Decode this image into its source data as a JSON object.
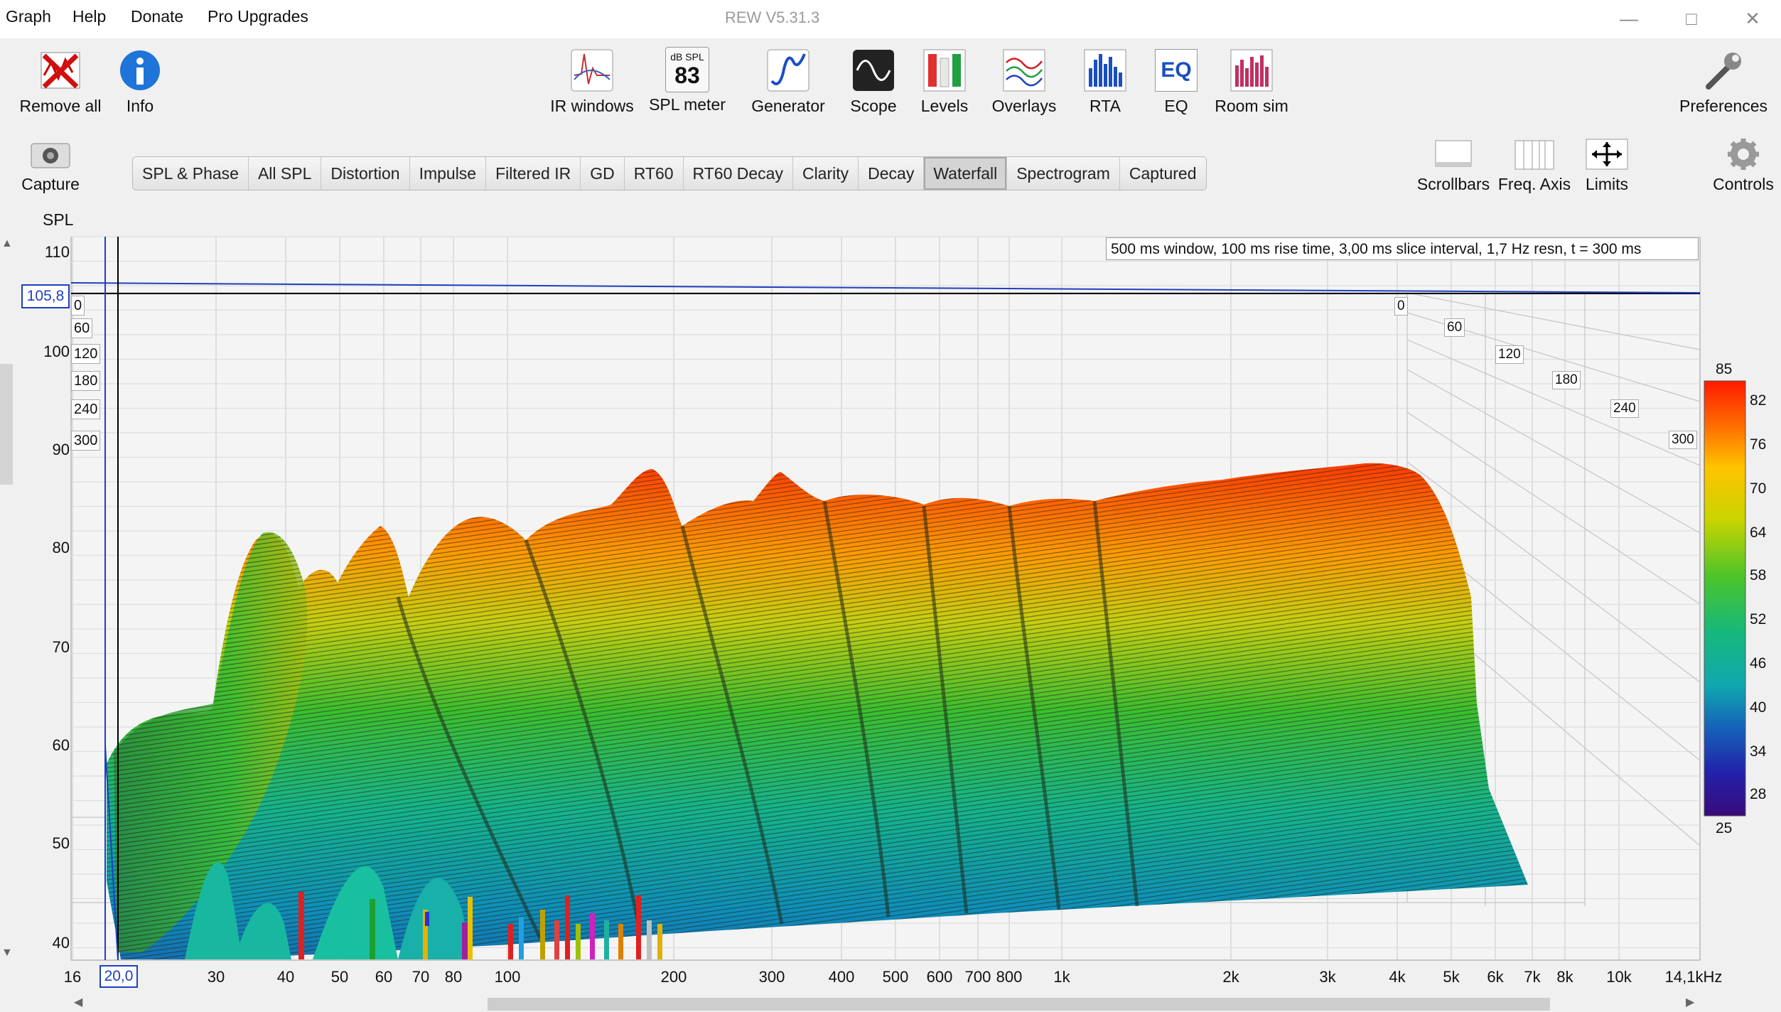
{
  "app": {
    "title": "REW V5.31.3",
    "menu": [
      "Graph",
      "Help",
      "Donate",
      "Pro Upgrades"
    ]
  },
  "toolbar": {
    "remove_all": "Remove all",
    "info": "Info",
    "ir_windows": "IR windows",
    "spl_meter": "SPL meter",
    "spl_meter_unit": "dB SPL",
    "spl_meter_value": "83",
    "generator": "Generator",
    "scope": "Scope",
    "levels": "Levels",
    "overlays": "Overlays",
    "rta": "RTA",
    "eq": "EQ",
    "eq_icon_text": "EQ",
    "room_sim": "Room sim",
    "preferences": "Preferences",
    "capture": "Capture",
    "scrollbars": "Scrollbars",
    "freq_axis": "Freq. Axis",
    "limits": "Limits",
    "controls": "Controls"
  },
  "tabs": [
    "SPL & Phase",
    "All SPL",
    "Distortion",
    "Impulse",
    "Filtered IR",
    "GD",
    "RT60",
    "RT60 Decay",
    "Clarity",
    "Decay",
    "Waterfall",
    "Spectrogram",
    "Captured"
  ],
  "active_tab": "Waterfall",
  "graph": {
    "y_axis_label": "SPL",
    "y_ticks": [
      "110",
      "100",
      "90",
      "80",
      "70",
      "60",
      "50",
      "40"
    ],
    "x_ticks": [
      "16",
      "30",
      "40",
      "50",
      "60",
      "70",
      "80",
      "100",
      "200",
      "300",
      "400",
      "500",
      "600",
      "700",
      "800",
      "1k",
      "2k",
      "3k",
      "4k",
      "5k",
      "6k",
      "7k",
      "8k",
      "10k",
      "14,1kHz"
    ],
    "cursor_x": "20,0",
    "cursor_y": "105,8",
    "info_text": "500 ms window, 100 ms rise time, 3,00 ms slice interval, 1,7 Hz resn, t = 300 ms",
    "time_labels_left": [
      "0",
      "60",
      "120",
      "180",
      "240",
      "300"
    ],
    "time_labels_right": [
      "0",
      "60",
      "120",
      "180",
      "240",
      "300"
    ],
    "color_scale": [
      "85",
      "82",
      "76",
      "70",
      "64",
      "58",
      "52",
      "46",
      "40",
      "34",
      "28",
      "25"
    ],
    "colors": {
      "cursor": "#1f3fc0",
      "grid": "#cfcfcf",
      "plot_bg": "#f4f4f4"
    }
  }
}
